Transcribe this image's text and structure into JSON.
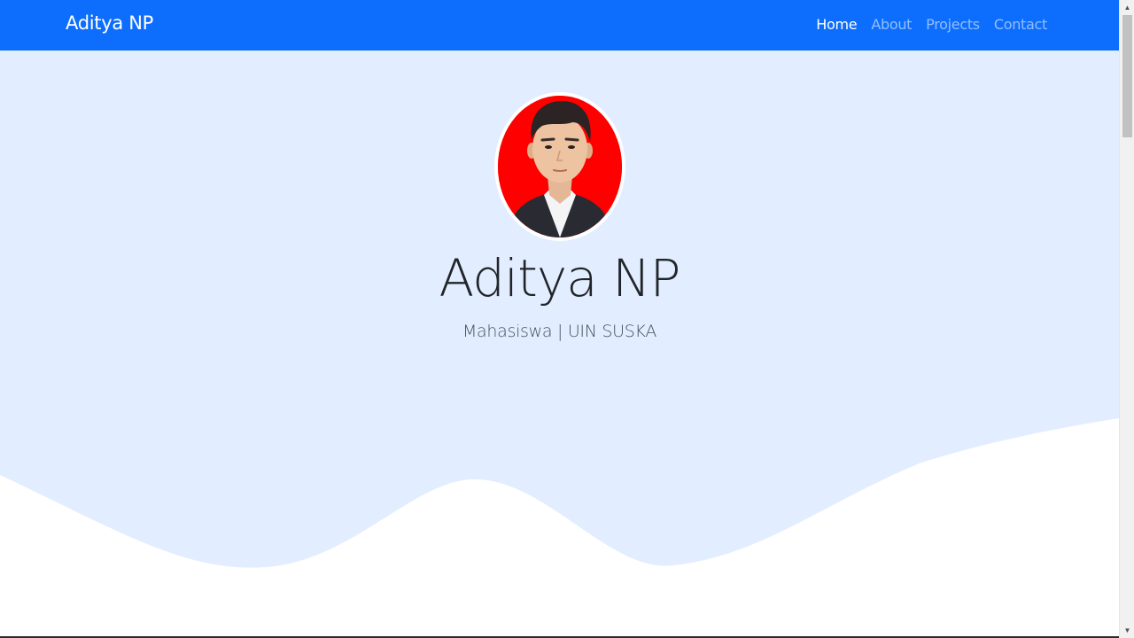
{
  "navbar": {
    "brand": "Aditya NP",
    "links": [
      {
        "label": "Home",
        "active": true
      },
      {
        "label": "About",
        "active": false
      },
      {
        "label": "Projects",
        "active": false
      },
      {
        "label": "Contact",
        "active": false
      }
    ]
  },
  "hero": {
    "name": "Aditya NP",
    "subtitle": "Mahasiswa | UIN SUSKA"
  },
  "colors": {
    "navbar_bg": "#0d6efd",
    "hero_bg": "#e2edff",
    "avatar_bg": "#ff0000"
  },
  "icons": {
    "scroll_up": "triangle-up",
    "scroll_down": "triangle-down"
  }
}
